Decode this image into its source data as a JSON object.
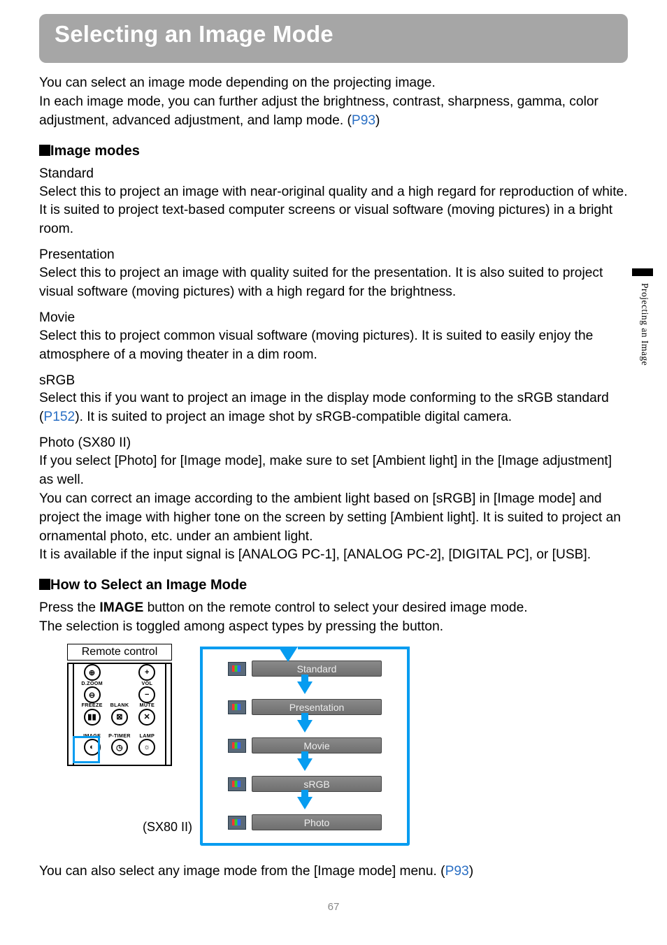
{
  "title": "Selecting an Image Mode",
  "intro_part1": "You can select an image mode depending on the projecting image.",
  "intro_part2a": "In each image mode, you can further adjust the brightness, contrast, sharpness, gamma, color adjustment, advanced adjustment, and lamp mode. (",
  "intro_link1": "P93",
  "intro_part2b": ")",
  "image_modes_heading": "Image modes",
  "modes": {
    "standard": {
      "title": "Standard",
      "desc": "Select this to project an image with near-original quality and a high regard for reproduction of white. It is suited to project text-based computer screens or visual software (moving pictures) in a bright room."
    },
    "presentation": {
      "title": "Presentation",
      "desc": "Select this to project an image with quality suited for the presentation. It is also suited to project visual software (moving pictures) with a high regard for the brightness."
    },
    "movie": {
      "title": "Movie",
      "desc": "Select this to project common visual software (moving pictures). It is suited to easily enjoy the atmosphere of a moving theater in a dim room."
    },
    "srgb": {
      "title": "sRGB",
      "desc_a": "Select this if you want to project an image in the display mode conforming to the sRGB standard (",
      "link": "P152",
      "desc_b": "). It is suited to project an image shot by sRGB-compatible digital camera."
    },
    "photo": {
      "title": "Photo (SX80 II)",
      "desc1": "If you select [Photo] for [Image mode], make sure to set [Ambient light] in the [Image adjustment] as well.",
      "desc2": "You can correct an image according to the ambient light based on [sRGB] in [Image mode] and project the image with higher tone on the screen by setting [Ambient light]. It is suited to project an ornamental photo, etc. under an ambient light.",
      "desc3": "It is available if the input signal is [ANALOG PC-1], [ANALOG PC-2], [DIGITAL PC], or [USB]."
    }
  },
  "howto_heading": "How to Select an Image Mode",
  "howto_a": "Press the ",
  "howto_btn": "IMAGE",
  "howto_b": " button on the remote control to select your desired image mode.",
  "howto_c": "The selection is toggled among aspect types by pressing the button.",
  "remote_label": "Remote control",
  "remote_buttons": {
    "dzoom": "D.ZOOM",
    "vol": "VOL",
    "freeze": "FREEZE",
    "blank": "BLANK",
    "mute": "MUTE",
    "image": "IMAGE",
    "ptimer": "P-TIMER",
    "lamp": "LAMP"
  },
  "flow_items": [
    "Standard",
    "Presentation",
    "Movie",
    "sRGB",
    "Photo"
  ],
  "sx_label": "(SX80 II)",
  "footer_a": "You can also select any image mode from the [Image mode] menu. (",
  "footer_link": "P93",
  "footer_b": ")",
  "page_number": "67",
  "side_tab": "Projecting an Image"
}
